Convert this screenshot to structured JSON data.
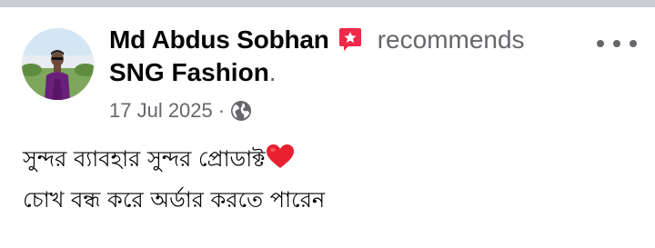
{
  "post": {
    "author": "Md Abdus Sobhan",
    "recommend_icon": "recommend-badge-icon",
    "action_text": "recommends",
    "page_name": "SNG Fashion",
    "period": ".",
    "date": "17 Jul 2025",
    "separator": "·",
    "audience_icon": "globe-icon",
    "menu_icon": "more-options-icon",
    "text_line1": "সুন্দর ব্যাবহার সুন্দর প্রোডাক্ট",
    "text_line2": "চোখ বন্ধ করে অর্ডার করতে পারেন",
    "emoji": "heart-emoji"
  },
  "colors": {
    "primary_text": "#050505",
    "secondary_text": "#65676b",
    "recommend_badge": "#f02849",
    "divider": "#c9ccd1",
    "heart": "#e8202f"
  }
}
